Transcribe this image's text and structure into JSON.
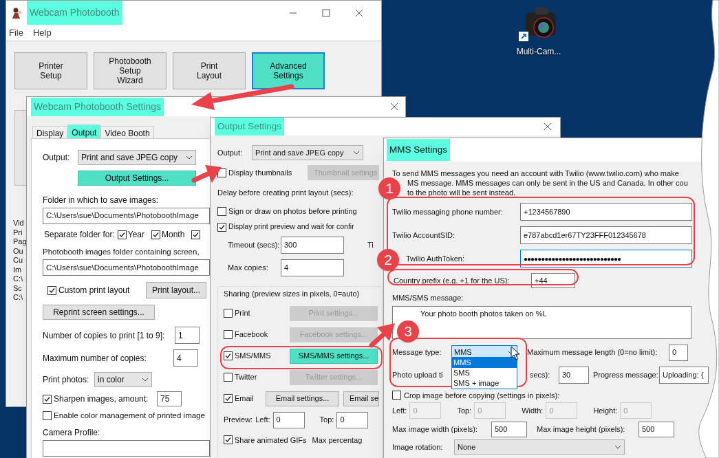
{
  "desktop": {
    "shortcut_label": "Multi-Cam..."
  },
  "main_window": {
    "title": "Webcam Photobooth",
    "menu": [
      "File",
      "Help"
    ],
    "buttons": [
      {
        "label": "Printer\nSetup",
        "selected": false
      },
      {
        "label": "Photobooth\nSetup\nWizard",
        "selected": false
      },
      {
        "label": "Print\nLayout",
        "selected": false
      },
      {
        "label": "Advanced\nSettings",
        "selected": true
      }
    ],
    "side_list": [
      "Vid",
      "Pri",
      "Pag",
      "Ou",
      "Cu",
      "Im",
      "C:\\",
      "Sc",
      "C:\\"
    ]
  },
  "settings_window": {
    "title": "Webcam Photobooth Settings",
    "tabs": [
      {
        "label": "Display",
        "selected": false
      },
      {
        "label": "Output",
        "selected": true
      },
      {
        "label": "Video Booth",
        "selected": false
      }
    ],
    "output": {
      "label": "Output:",
      "value": "Print and save JPEG copy"
    },
    "output_settings_button": "Output Settings...",
    "save_folder": {
      "label": "Folder in which to save images:",
      "value": "C:\\Users\\sue\\Documents\\PhotoboothImage"
    },
    "separate_folder": {
      "label": "Separate folder for:",
      "options": [
        {
          "label": "Year",
          "checked": true
        },
        {
          "label": "Month",
          "checked": true
        },
        {
          "checked": true
        }
      ]
    },
    "screen_folder": {
      "label": "Photobooth images folder containing screen,",
      "value": "C:\\Users\\sue\\Documents\\PhotoboothImage"
    },
    "custom_print_layout": {
      "label": "Custom print layout",
      "checked": true
    },
    "print_layout_button": "Print layout...",
    "reprint_button": "Reprint screen settings...",
    "copies": {
      "label": "Number of copies to print [1 to 9]:",
      "value": "1"
    },
    "max_copies": {
      "label": "Maximum number of copies:",
      "value": "4"
    },
    "print_photos": {
      "label": "Print photos:",
      "value": "in color"
    },
    "sharpen": {
      "label": "Sharpen images, amount:",
      "checked": true,
      "value": "75"
    },
    "color_management": {
      "label": "Enable color management of printed image",
      "checked": false
    },
    "camera_profile": {
      "label": "Camera Profile:"
    }
  },
  "output_window": {
    "title": "Output Settings",
    "output": {
      "label": "Output:",
      "value": "Print and save JPEG copy"
    },
    "display_thumbnails": {
      "label": "Display thumbnails",
      "checked": false
    },
    "thumbnail_button": {
      "label": "Thumbnail settings",
      "disabled": true
    },
    "delay_label": "Delay before creating print layout (secs):",
    "sign": {
      "label": "Sign or draw on photos before printing",
      "checked": false
    },
    "print_preview": {
      "label": "Display print preview and wait for confir",
      "checked": true
    },
    "timeout": {
      "label": "Timeout (secs):",
      "value": "300"
    },
    "cut_label": "Ti",
    "max_copies": {
      "label": "Max copies:",
      "value": "4"
    },
    "sharing": {
      "title": "Sharing (preview sizes in pixels, 0=auto)",
      "services": [
        {
          "label": "Print",
          "checked": false,
          "button": "Print settings...",
          "disabled": true,
          "highlighted": false
        },
        {
          "label": "Facebook",
          "checked": false,
          "button": "Facebook settings...",
          "disabled": true,
          "highlighted": false
        },
        {
          "label": "SMS/MMS",
          "checked": true,
          "button": "SMS/MMS settings...",
          "disabled": false,
          "highlighted": true
        },
        {
          "label": "Twitter",
          "checked": false,
          "button": "Twitter settings...",
          "disabled": true,
          "highlighted": false
        },
        {
          "label": "Email",
          "checked": true,
          "button": "Email settings...",
          "disabled": false,
          "highlighted": false
        }
      ]
    },
    "email_second_button": "Email se",
    "preview": {
      "label": "Preview:",
      "left_label": "Left:",
      "left_value": "0",
      "top_label": "Top:",
      "top_value": "0"
    },
    "animated_gifs": {
      "label": "Share animated GIFs",
      "checked": true
    },
    "max_percentage_label": "Max percentag"
  },
  "mms_window": {
    "title": "MMS Settings",
    "intro": [
      "To send MMS messages you need an account with Twilio (www.twilio.com) who make",
      "MS message. MMS messages can only be sent in the US and Canada. In other cou",
      "to the photo will be sent instead."
    ],
    "phone": {
      "label": "Twilio messaging phone number:",
      "value": "+1234567890"
    },
    "account_sid": {
      "label": "Twilio AccountSID:",
      "value": "e787abcd1er67TY23FFF012345678"
    },
    "auth_token": {
      "label": "Twilio AuthToken:",
      "value": "●●●●●●●●●●●●●●●●●●●●●●●●●●●●"
    },
    "country_prefix": {
      "label": "Country prefix (e.g. +1 for the US):",
      "value": "+44"
    },
    "message": {
      "label": "MMS/SMS message:",
      "value": "Your photo booth photos taken on %L"
    },
    "message_type": {
      "label": "Message type:",
      "value": "MMS",
      "options": [
        {
          "label": "MMS",
          "selected": true
        },
        {
          "label": "SMS",
          "selected": false
        },
        {
          "label": "SMS + image",
          "selected": false
        }
      ]
    },
    "max_length": {
      "label": "Maximum message length (0=no limit):",
      "value": "0"
    },
    "upload_timeout": {
      "label_start": "Photo upload ti",
      "label_end": "secs):",
      "value": "30"
    },
    "progress": {
      "label": "Progress message:",
      "value": "Uploading: {"
    },
    "crop": {
      "label": "Crop image before copying (settings in pixels):",
      "checked": false
    },
    "crop_fields": [
      {
        "label": "Left:",
        "value": "0"
      },
      {
        "label": "Top:",
        "value": "0"
      },
      {
        "label": "Width:",
        "value": "0"
      },
      {
        "label": "Height:",
        "value": "0"
      }
    ],
    "max_width": {
      "label": "Max image width (pixels):",
      "value": "500"
    },
    "max_height": {
      "label": "Max image height (pixels):",
      "value": "500"
    },
    "rotation": {
      "label": "Image rotation:",
      "value": "None"
    }
  },
  "annotations": {
    "steps": [
      "1",
      "2",
      "3"
    ]
  }
}
